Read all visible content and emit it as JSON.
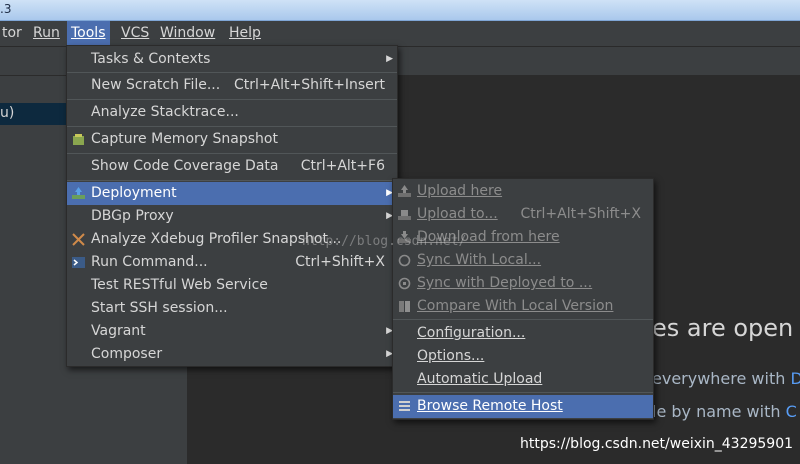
{
  "window": {
    "title_fragment": ".3"
  },
  "menubar": [
    "tor",
    "Run",
    "Tools",
    "VCS",
    "Window",
    "Help"
  ],
  "project_panel": {
    "selected_item": "u)"
  },
  "tools_menu": [
    {
      "label": "Tasks & Contexts",
      "shortcut": "",
      "submenu": true
    },
    {
      "label": "New Scratch File...",
      "shortcut": "Ctrl+Alt+Shift+Insert",
      "submenu": false
    },
    {
      "label": "Analyze Stacktrace...",
      "shortcut": "",
      "submenu": false
    },
    {
      "label": "Capture Memory Snapshot",
      "shortcut": "",
      "submenu": false,
      "icon": "memory-snapshot-icon"
    },
    {
      "label": "Show Code Coverage Data",
      "shortcut": "Ctrl+Alt+F6",
      "submenu": false
    },
    {
      "label": "Deployment",
      "shortcut": "",
      "submenu": true,
      "icon": "deployment-icon",
      "highlighted": true
    },
    {
      "label": "DBGp Proxy",
      "shortcut": "",
      "submenu": true
    },
    {
      "label": "Analyze Xdebug Profiler Snapshot...",
      "shortcut": "",
      "submenu": false,
      "icon": "xdebug-icon"
    },
    {
      "label": "Run Command...",
      "shortcut": "Ctrl+Shift+X",
      "submenu": false,
      "icon": "terminal-icon"
    },
    {
      "label": "Test RESTful Web Service",
      "shortcut": "",
      "submenu": false
    },
    {
      "label": "Start SSH session...",
      "shortcut": "",
      "submenu": false
    },
    {
      "label": "Vagrant",
      "shortcut": "",
      "submenu": true
    },
    {
      "label": "Composer",
      "shortcut": "",
      "submenu": true
    }
  ],
  "deployment_menu": [
    {
      "label": "Upload here",
      "shortcut": "",
      "disabled": true,
      "icon": "upload-icon"
    },
    {
      "label": "Upload to...",
      "shortcut": "Ctrl+Alt+Shift+X",
      "disabled": true,
      "icon": "upload-to-icon"
    },
    {
      "label": "Download from here",
      "shortcut": "",
      "disabled": true,
      "icon": "download-icon"
    },
    {
      "label": "Sync With Local...",
      "shortcut": "",
      "disabled": true,
      "icon": "sync-icon"
    },
    {
      "label": "Sync with Deployed to ...",
      "shortcut": "",
      "disabled": true,
      "icon": "sync-deployed-icon"
    },
    {
      "label": "Compare With Local Version",
      "shortcut": "",
      "disabled": true,
      "icon": "compare-icon"
    },
    {
      "label": "Configuration...",
      "shortcut": "",
      "disabled": false
    },
    {
      "label": "Options...",
      "shortcut": "",
      "disabled": false
    },
    {
      "label": "Automatic Upload",
      "shortcut": "",
      "disabled": false
    },
    {
      "label": "Browse Remote Host",
      "shortcut": "",
      "disabled": false,
      "highlighted": true,
      "icon": "remote-host-icon"
    }
  ],
  "editor_hints": {
    "title": "es are open",
    "line1": "everywhere with",
    "line1_key": "Do",
    "line2": "le by name with",
    "line2_key": "C"
  },
  "watermarks": {
    "diagonal": "http://blog.csdn.net/",
    "url": "https://blog.csdn.net/weixin_43295901"
  },
  "colors": {
    "highlight": "#4b6eaf",
    "menu_bg": "#3c3f41",
    "editor_bg": "#2b2b2b",
    "link_blue": "#589df6"
  }
}
